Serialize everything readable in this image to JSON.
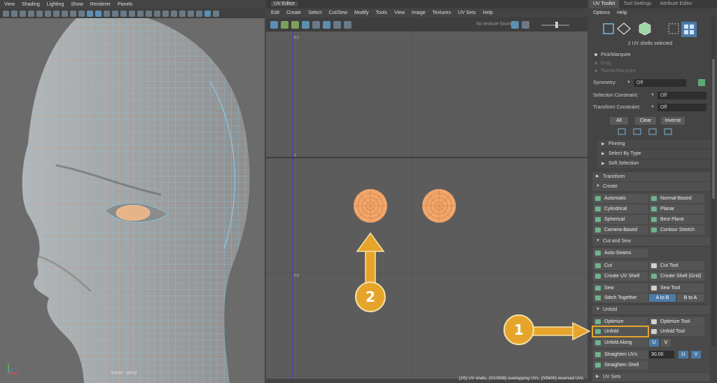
{
  "viewport": {
    "menu": [
      "View",
      "Shading",
      "Lighting",
      "Show",
      "Renderer",
      "Panels"
    ],
    "camera_label": "Isolate : persp"
  },
  "uv_editor": {
    "title": "UV Editor",
    "menu": [
      "Edit",
      "Create",
      "Select",
      "Cut/Sew",
      "Modify",
      "Tools",
      "View",
      "Image",
      "Textures",
      "UV Sets",
      "Help"
    ],
    "texture_label": "No texture found",
    "grid_labels": [
      "0.1",
      "1",
      "0.9"
    ],
    "status": "(2/5) UV shells, (0/10636) overlapping UVs, (0/5600) reversed UVs"
  },
  "toolkit": {
    "tabs": [
      "UV Toolkit",
      "Tool Settings",
      "Attribute Editor"
    ],
    "menu": [
      "Options",
      "Help"
    ],
    "selection_count": "2 UV shells selected",
    "modes": [
      "Pick/Marquee",
      "Drag",
      "Tweak/Marquee"
    ],
    "symmetry": {
      "label": "Symmetry:",
      "value": "Off"
    },
    "selection_constraint": {
      "label": "Selection Constraint:",
      "value": "Off"
    },
    "transform_constraint": {
      "label": "Transform Constraint:",
      "value": "Off"
    },
    "select_buttons": [
      "All",
      "Clear",
      "Inverse"
    ],
    "subsections": [
      "Pinning",
      "Select By Type",
      "Soft Selection"
    ],
    "sections": {
      "transform": "Transform",
      "create": "Create",
      "cut_and_sew": "Cut and Sew",
      "unfold": "Unfold",
      "uv_sets": "UV Sets"
    },
    "create_tools": [
      "Automatic",
      "Normal-Based",
      "Cylindrical",
      "Planar",
      "Spherical",
      "Best Plane",
      "Camera-Based",
      "Contour Stretch"
    ],
    "cut_tools": {
      "auto_seams": "Auto-Seams",
      "cut": "Cut",
      "cut_tool": "Cut Tool",
      "create_uv_shell": "Create UV Shell",
      "create_shell_grid": "Create Shell (Grid)",
      "sew": "Sew",
      "sew_tool": "Sew Tool",
      "stitch_together": "Stitch Together",
      "a_to_b": "A to B",
      "b_to_a": "B to A"
    },
    "unfold_tools": {
      "optimize": "Optimize",
      "optimize_tool": "Optimize Tool",
      "unfold": "Unfold",
      "unfold_tool": "Unfold Tool",
      "unfold_along": "Unfold Along",
      "u": "U",
      "v": "V",
      "straighten_uvs": "Straighten UVs",
      "straighten_value": "30.00",
      "straighten_shell": "Straighten Shell"
    }
  },
  "callouts": [
    "1",
    "2"
  ],
  "colors": {
    "callout": "#e6a52a",
    "accent": "#4d7aa6",
    "wire": "#7fd9ff",
    "uv_shell": "#f2a66a"
  }
}
